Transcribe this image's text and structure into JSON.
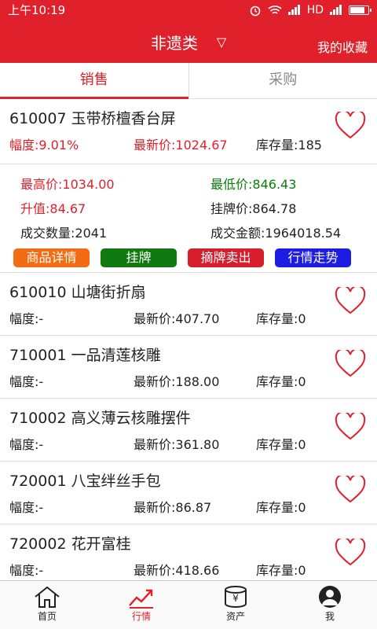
{
  "status": {
    "time": "上午10:19",
    "network": "HD",
    "battery_level": 0.85
  },
  "header": {
    "title": "非遗类",
    "dropdown_icon": "▽",
    "favorites": "我的收藏"
  },
  "tabs": [
    {
      "label": "销售"
    },
    {
      "label": "采购"
    }
  ],
  "labels": {
    "amplitude": "幅度:",
    "latest_price": "最新价:",
    "stock": "库存量:",
    "high": "最高价:",
    "low": "最低价:",
    "rise": "升值:",
    "listed_price": "挂牌价:",
    "volume": "成交数量:",
    "amount": "成交金额:"
  },
  "expanded_item": {
    "name": "610007 玉带桥檀香台屏",
    "amplitude": "9.01%",
    "latest_price": "1024.67",
    "stock": "185",
    "high": "1034.00",
    "low": "846.43",
    "rise": "84.67",
    "listed_price": "864.78",
    "volume": "2041",
    "amount": "1964018.54",
    "buttons": {
      "details": "商品详情",
      "list": "挂牌",
      "delist_sell": "摘牌卖出",
      "trend": "行情走势"
    }
  },
  "items": [
    {
      "name": "610010 山塘街折扇",
      "amplitude": "-",
      "latest_price": "407.70",
      "stock": "0"
    },
    {
      "name": "710001 一品清莲核雕",
      "amplitude": "-",
      "latest_price": "188.00",
      "stock": "0"
    },
    {
      "name": "710002 高义薄云核雕摆件",
      "amplitude": "-",
      "latest_price": "361.80",
      "stock": "0"
    },
    {
      "name": "720001 八宝绊丝手包",
      "amplitude": "-",
      "latest_price": "86.87",
      "stock": "0"
    },
    {
      "name": "720002 花开富桂",
      "amplitude": "-",
      "latest_price": "418.66",
      "stock": "0"
    }
  ],
  "nav": [
    {
      "label": "首页",
      "icon": "home-icon"
    },
    {
      "label": "行情",
      "icon": "market-trend-icon"
    },
    {
      "label": "资产",
      "icon": "assets-yuan-icon"
    },
    {
      "label": "我",
      "icon": "user-icon"
    }
  ],
  "colors": {
    "brand_red": "#e0202a",
    "gain_green": "#0a7d0a"
  }
}
